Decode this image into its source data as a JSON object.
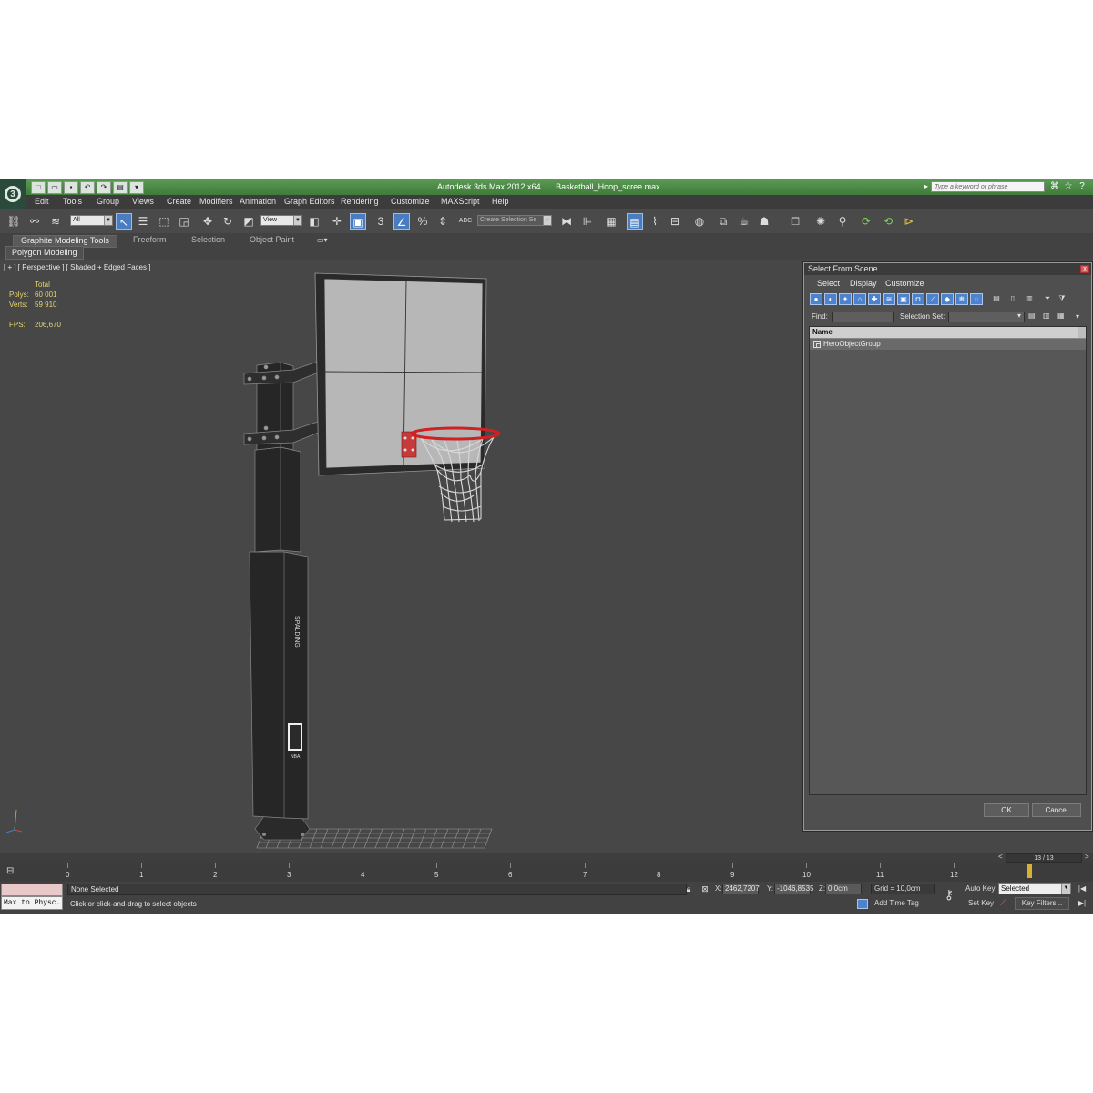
{
  "window": {
    "app_title": "Autodesk 3ds Max  2012 x64",
    "file_name": "Basketball_Hoop_scree.max",
    "search_placeholder": "Type a keyword or phrase"
  },
  "menu": [
    "Edit",
    "Tools",
    "Group",
    "Views",
    "Create",
    "Modifiers",
    "Animation",
    "Graph Editors",
    "Rendering",
    "Customize",
    "MAXScript",
    "Help"
  ],
  "toolbar": {
    "filter_value": "All",
    "coord_value": "View",
    "selection_set_placeholder": "Create Selection Se",
    "snap_label": "3",
    "abc_label": "ABC"
  },
  "ribbon": {
    "tabs": [
      "Graphite Modeling Tools",
      "Freeform",
      "Selection",
      "Object Paint"
    ],
    "sub_panel": "Polygon Modeling"
  },
  "viewport": {
    "label": "[ + ] [ Perspective ] [ Shaded + Edged Faces ]",
    "stats_header": "Total",
    "polys_label": "Polys:",
    "polys_value": "60 001",
    "verts_label": "Verts:",
    "verts_value": "59 910",
    "fps_label": "FPS:",
    "fps_value": "206,670",
    "scene_labels": {
      "brand": "SPALDING",
      "league": "NBA"
    }
  },
  "dialog": {
    "title": "Select From Scene",
    "menu": [
      "Select",
      "Display",
      "Customize"
    ],
    "find_label": "Find:",
    "find_value": "",
    "selection_set_label": "Selection Set:",
    "selection_set_value": "",
    "column_header": "Name",
    "items": [
      "HeroObjectGroup"
    ],
    "ok_label": "OK",
    "cancel_label": "Cancel"
  },
  "timeline": {
    "frame_counter": "13 / 13",
    "frame_labels": [
      "0",
      "1",
      "2",
      "3",
      "4",
      "5",
      "6",
      "7",
      "8",
      "9",
      "10",
      "11",
      "12"
    ],
    "current_frame": 13,
    "total_frames": 13
  },
  "status": {
    "maxscript_text": "Max to Physc.",
    "selection_text": "None Selected",
    "prompt_text": "Click or click-and-drag to select objects",
    "x_label": "X:",
    "x_value": "2462,7207",
    "y_label": "Y:",
    "y_value": "-1046,8535",
    "z_label": "Z:",
    "z_value": "0,0cm",
    "grid_text": "Grid = 10,0cm",
    "add_time_tag": "Add Time Tag",
    "auto_key": "Auto Key",
    "set_key": "Set Key",
    "key_mode_value": "Selected",
    "key_filters": "Key Filters..."
  },
  "colors": {
    "title_bar": "#4a8a44",
    "viewport_bg": "#474747",
    "active_viewport_border": "#c6a22a",
    "selected_tool": "#4a7cc0",
    "stats_text": "#e8d56a",
    "rim": "#d22020"
  }
}
